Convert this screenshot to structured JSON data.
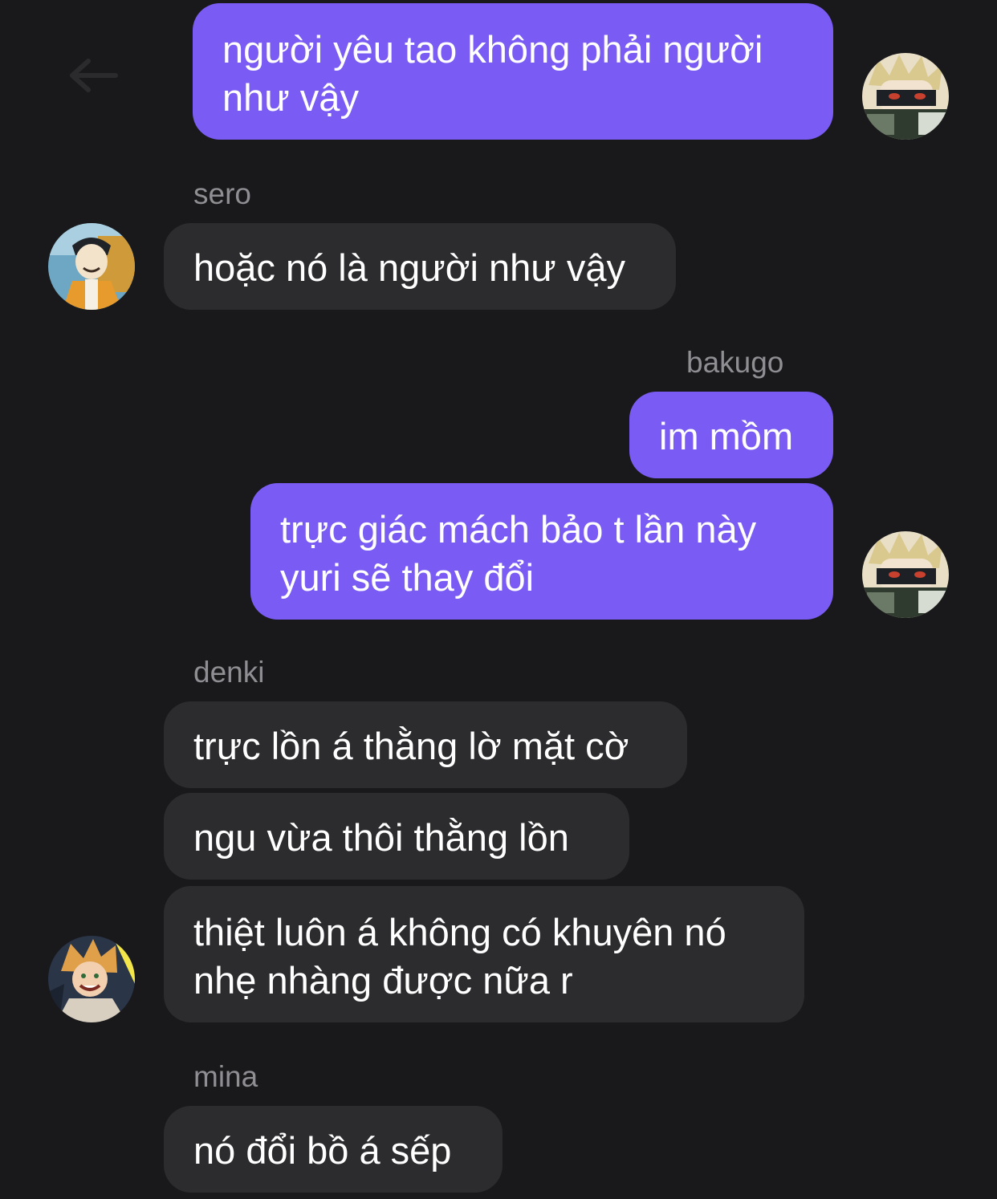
{
  "chat": {
    "messages": [
      {
        "from": "me",
        "text_line1": "người yêu tao không phải người",
        "text_line2": "như vậy"
      },
      {
        "from": "sero",
        "sender": "sero",
        "text": "hoặc nó là người như vậy"
      },
      {
        "from": "me",
        "sender": "bakugo",
        "text": "im mồm"
      },
      {
        "from": "me",
        "text_line1": "trực giác mách bảo t lần này",
        "text_line2": "yuri sẽ thay đổi"
      },
      {
        "from": "denki",
        "sender": "denki",
        "text": "trực lồn á thằng lờ mặt cờ"
      },
      {
        "from": "denki",
        "text": "ngu vừa thôi thằng lồn"
      },
      {
        "from": "denki",
        "text_line1": "thiệt luôn á không có khuyên nó",
        "text_line2": "nhẹ nhàng được nữa r"
      },
      {
        "from": "mina",
        "sender": "mina",
        "text": "nó đổi bồ á sếp"
      }
    ]
  },
  "colors": {
    "background": "#19191b",
    "outgoing_bubble": "#7a5cf4",
    "incoming_bubble": "#2c2c2f",
    "sender_name": "#8e8e93"
  },
  "icons": {
    "back": "back-arrow-icon",
    "avatars": [
      "bakugo-avatar",
      "sero-avatar",
      "denki-avatar"
    ]
  }
}
